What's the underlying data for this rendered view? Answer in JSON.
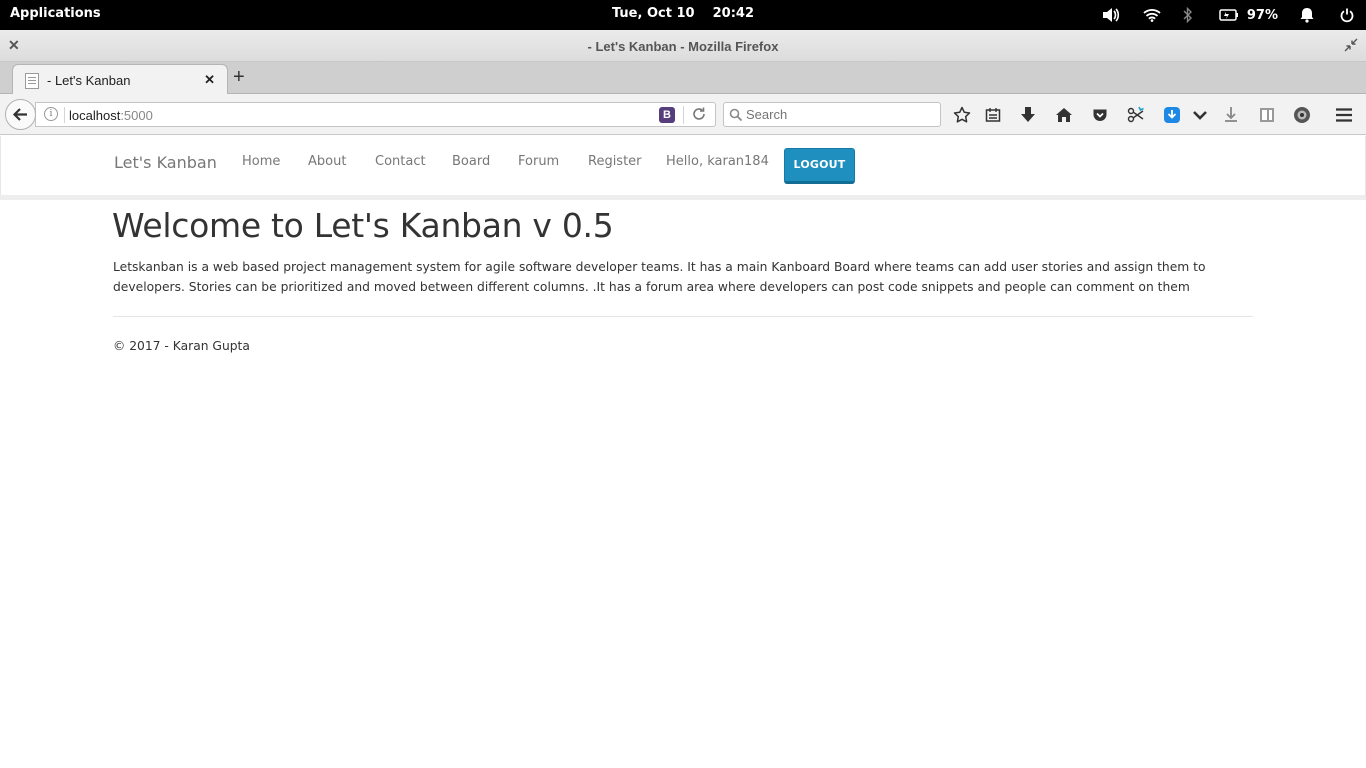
{
  "system": {
    "applications_label": "Applications",
    "datetime": "Tue, Oct 10    20:42",
    "battery": "97%"
  },
  "window": {
    "title": "- Let's Kanban - Mozilla Firefox"
  },
  "browser": {
    "tab_title": "- Let's Kanban",
    "url_host": "localhost",
    "url_port": ":5000",
    "search_placeholder": "Search"
  },
  "site": {
    "brand": "Let's Kanban",
    "nav": {
      "home": "Home",
      "about": "About",
      "contact": "Contact",
      "board": "Board",
      "forum": "Forum",
      "register": "Register",
      "hello": "Hello, karan184"
    },
    "logout_label": "LOGOUT",
    "heading": "Welcome to Let's Kanban v 0.5",
    "intro": "Letskanban is a web based project management system for agile software developer teams. It has a main Kanboard Board where teams can add user stories and assign them to developers. Stories can be prioritized and moved between different columns. .It has a forum area where developers can post code snippets and people can comment on them",
    "footer": "© 2017 - Karan Gupta"
  }
}
